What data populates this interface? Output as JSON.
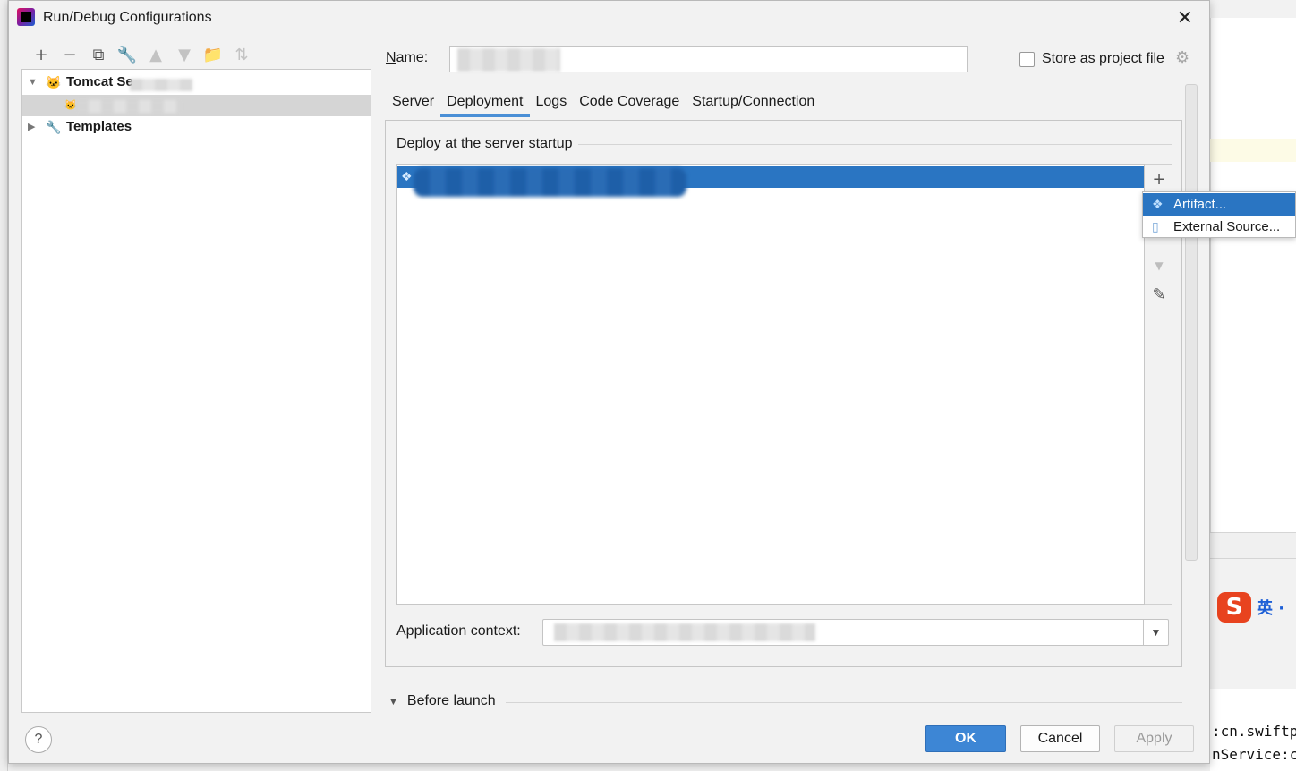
{
  "window": {
    "title": "Run/Debug Configurations",
    "close_glyph": "✕"
  },
  "toolbar": {
    "buttons": [
      {
        "name": "add",
        "glyph": "+"
      },
      {
        "name": "remove",
        "glyph": "−"
      },
      {
        "name": "copy",
        "glyph": "⧉"
      },
      {
        "name": "edit-defaults",
        "glyph": "🔧"
      },
      {
        "name": "move-up",
        "glyph": "▲"
      },
      {
        "name": "move-down",
        "glyph": "▼"
      },
      {
        "name": "new-folder",
        "glyph": "📁"
      },
      {
        "name": "sort",
        "glyph": "⇅"
      }
    ]
  },
  "tree": {
    "group_label": "Tomcat Se",
    "templates_label": "Templates"
  },
  "form": {
    "name_label": "Name:",
    "name_mnemonic": "N",
    "store_label": "Store as project file",
    "store_checked": false
  },
  "tabs": [
    "Server",
    "Deployment",
    "Logs",
    "Code Coverage",
    "Startup/Connection"
  ],
  "active_tab": "Deployment",
  "deployment": {
    "section_title": "Deploy at the server startup",
    "side_buttons": [
      {
        "name": "add",
        "glyph": "+"
      },
      {
        "name": "move-down",
        "glyph": "▼"
      },
      {
        "name": "edit",
        "glyph": "✎"
      }
    ],
    "context_label": "Application context:"
  },
  "popup_menu": {
    "items": [
      {
        "label": "Artifact...",
        "icon": "artifact-icon",
        "highlighted": true
      },
      {
        "label": "External Source...",
        "icon": "external-source-icon",
        "highlighted": false
      }
    ]
  },
  "before_launch": "Before launch",
  "buttons": {
    "ok": "OK",
    "cancel": "Cancel",
    "apply": "Apply",
    "help": "?"
  },
  "background": {
    "console_lines": [
      ":cn.swiftp",
      "nService:c"
    ],
    "ime_logo": "S",
    "ime_label": "英 ·"
  },
  "colors": {
    "accent": "#2a75c2",
    "ok_button": "#3d86d5",
    "tab_underline": "#4a8fd6"
  }
}
